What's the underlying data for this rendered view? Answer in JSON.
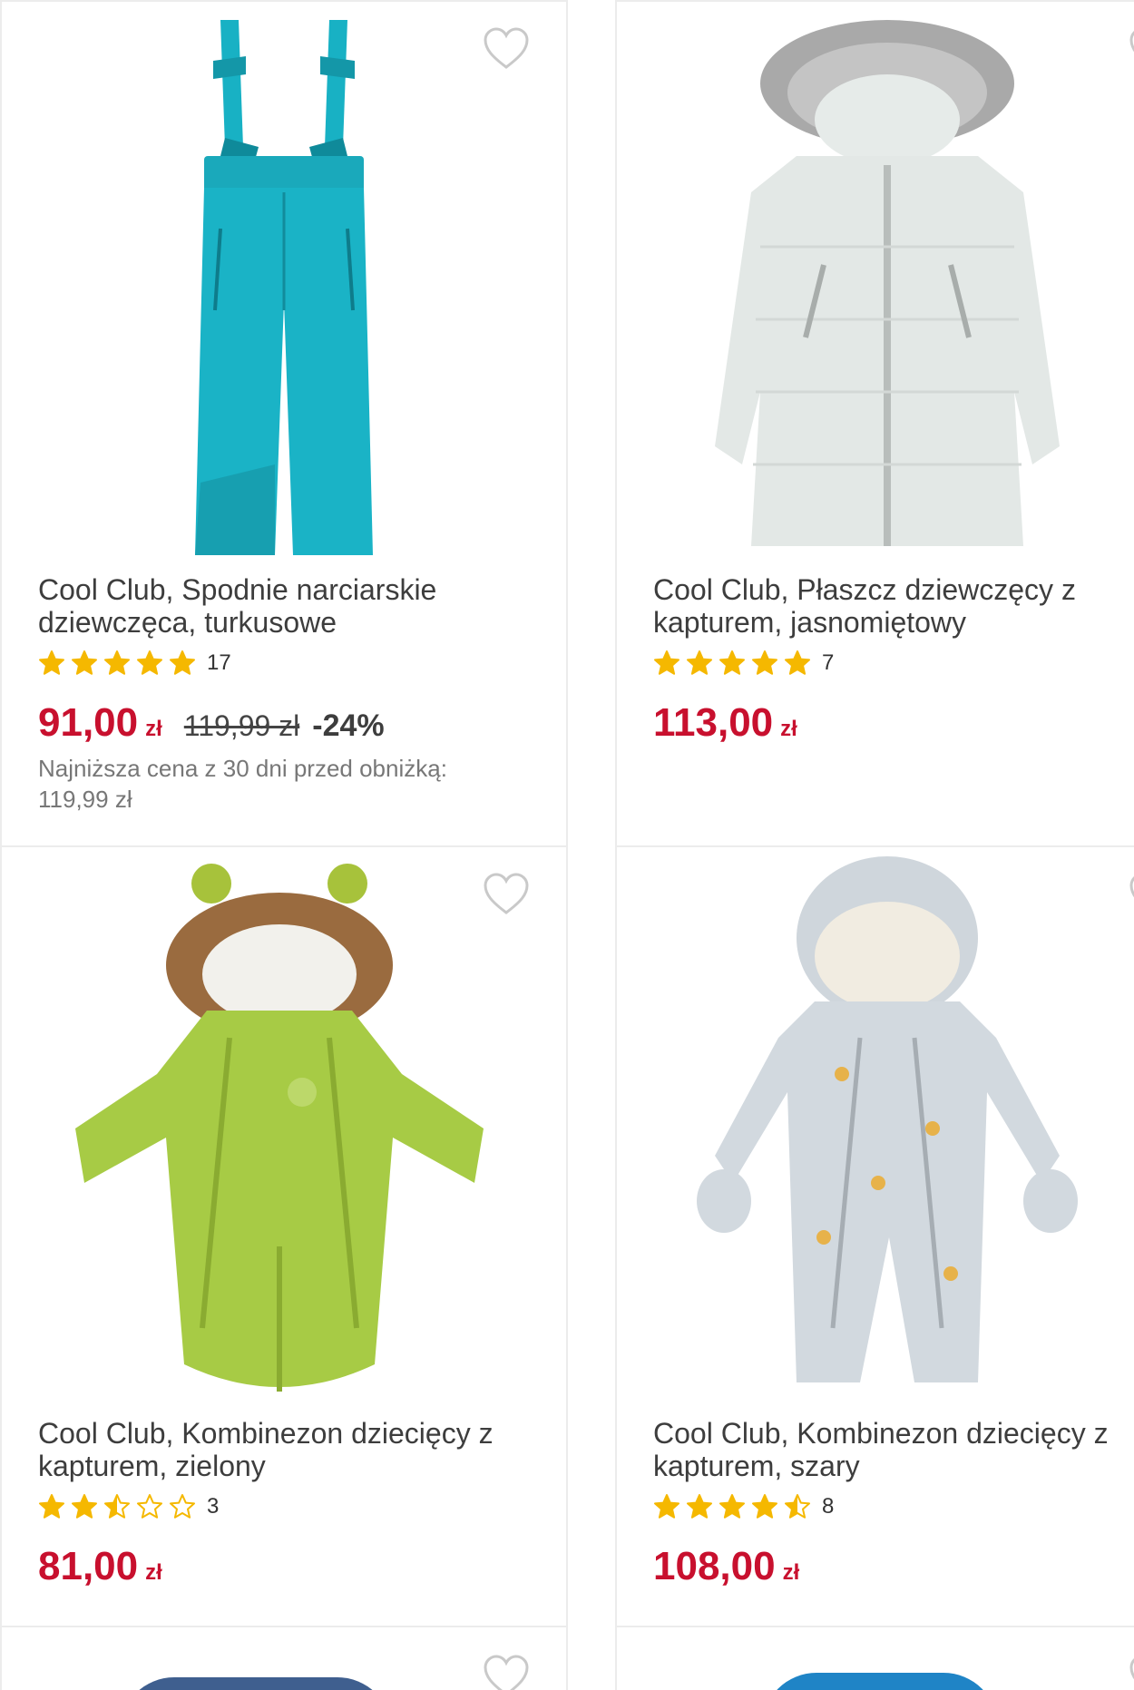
{
  "colors": {
    "price": "#c8102e",
    "star": "#f5b800",
    "border": "#ececec"
  },
  "products": [
    {
      "title": "Cool Club, Spodnie narciarskie dziewczęca, turkusowe",
      "rating": 5,
      "reviews": "17",
      "price": "91,00",
      "currency": "zł",
      "old_price": "119,99 zł",
      "discount": "-24%",
      "lowest_label": "Najniższa cena z 30 dni przed obniżką:",
      "lowest_value": "119,99 zł",
      "image": "turquoise-ski-pants"
    },
    {
      "title": "Cool Club, Płaszcz dziewczęcy z kapturem, jasnomiętowy",
      "rating": 5,
      "reviews": "7",
      "price": "113,00",
      "currency": "zł",
      "image": "mint-hooded-coat"
    },
    {
      "title": "Cool Club, Kombinezon dziecięcy z kapturem, zielony",
      "rating": 2.5,
      "reviews": "3",
      "price": "81,00",
      "currency": "zł",
      "image": "green-baby-snowsuit"
    },
    {
      "title": "Cool Club, Kombinezon dziecięcy z kapturem, szary",
      "rating": 4.5,
      "reviews": "8",
      "price": "108,00",
      "currency": "zł",
      "image": "grey-hooded-snowsuit"
    }
  ]
}
